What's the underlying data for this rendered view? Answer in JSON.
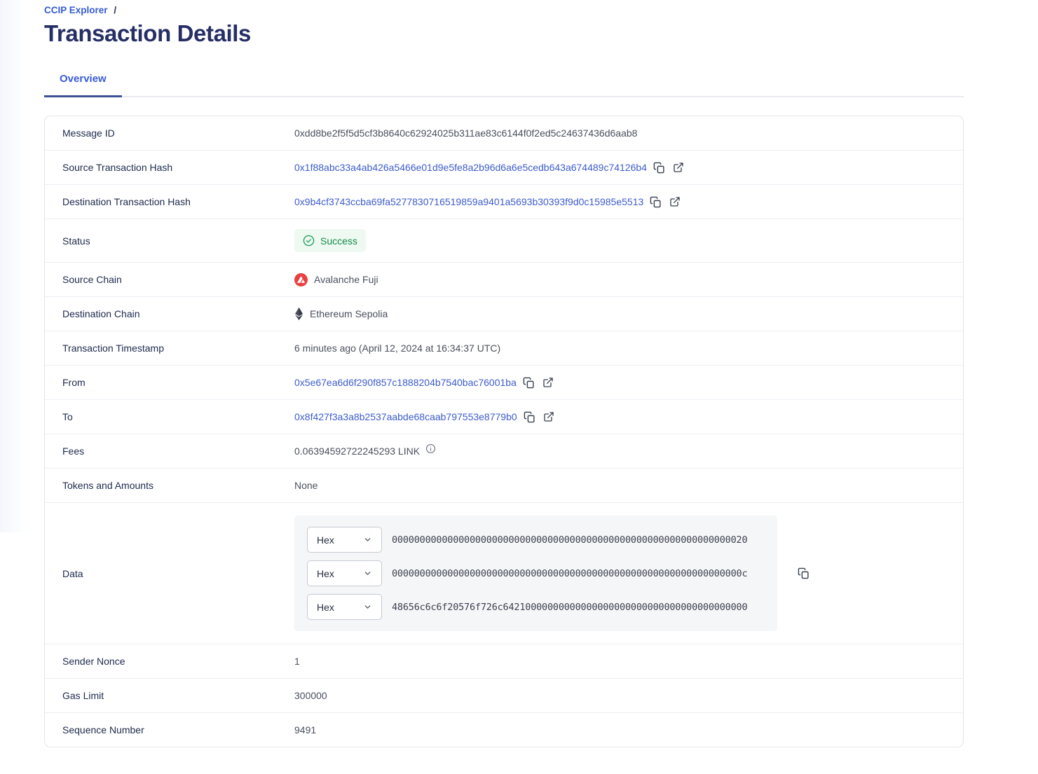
{
  "breadcrumb": {
    "link": "CCIP Explorer",
    "separator": "/"
  },
  "page_title": "Transaction Details",
  "tabs": [
    {
      "label": "Overview",
      "active": true
    }
  ],
  "colors": {
    "brand_blue": "#375bd2",
    "title_navy": "#262e66",
    "link_blue": "#3e5ccb",
    "success_green": "#178a4b",
    "success_bg": "#edf9f1",
    "avalanche_red": "#e84142",
    "data_panel_bg": "#f5f6f8"
  },
  "icons_used": [
    "copy-icon",
    "external-link-icon",
    "check-circle-icon",
    "avalanche-icon",
    "ethereum-icon",
    "info-icon",
    "chevron-down-icon"
  ],
  "rows": [
    {
      "label": "Message ID",
      "type": "plain",
      "value": "0xdd8be2f5f5d5cf3b8640c62924025b311ae83c6144f0f2ed5c24637436d6aab8"
    },
    {
      "label": "Source Transaction Hash",
      "type": "link",
      "value": "0x1f88abc33a4ab426a5466e01d9e5fe8a2b96d6a6e5cedb643a674489c74126b4",
      "actions": [
        "copy-icon",
        "external-link-icon"
      ]
    },
    {
      "label": "Destination Transaction Hash",
      "type": "link",
      "value": "0x9b4cf3743ccba69fa5277830716519859a9401a5693b30393f9d0c15985e5513",
      "actions": [
        "copy-icon",
        "external-link-icon"
      ]
    },
    {
      "label": "Status",
      "type": "status",
      "value": "Success",
      "icon": "check-circle-icon"
    },
    {
      "label": "Source Chain",
      "type": "chain",
      "value": "Avalanche Fuji",
      "icon": "avalanche-icon"
    },
    {
      "label": "Destination Chain",
      "type": "chain",
      "value": "Ethereum Sepolia",
      "icon": "ethereum-icon"
    },
    {
      "label": "Transaction Timestamp",
      "type": "plain",
      "value": "6 minutes ago (April 12, 2024 at 16:34:37 UTC)"
    },
    {
      "label": "From",
      "type": "link",
      "value": "0x5e67ea6d6f290f857c1888204b7540bac76001ba",
      "actions": [
        "copy-icon",
        "external-link-icon"
      ]
    },
    {
      "label": "To",
      "type": "link",
      "value": "0x8f427f3a3a8b2537aabde68caab797553e8779b0",
      "actions": [
        "copy-icon",
        "external-link-icon"
      ]
    },
    {
      "label": "Fees",
      "type": "fees",
      "value": "0.06394592722245293 LINK",
      "icon": "info-icon"
    },
    {
      "label": "Tokens and Amounts",
      "type": "plain",
      "value": "None"
    },
    {
      "label": "Data",
      "type": "data",
      "selector_label": "Hex",
      "action": "copy-icon",
      "lines": [
        "0000000000000000000000000000000000000000000000000000000000000020",
        "000000000000000000000000000000000000000000000000000000000000000c",
        "48656c6c6f20576f726c64210000000000000000000000000000000000000000"
      ]
    },
    {
      "label": "Sender Nonce",
      "type": "plain",
      "value": "1"
    },
    {
      "label": "Gas Limit",
      "type": "plain",
      "value": "300000"
    },
    {
      "label": "Sequence Number",
      "type": "plain",
      "value": "9491"
    }
  ]
}
